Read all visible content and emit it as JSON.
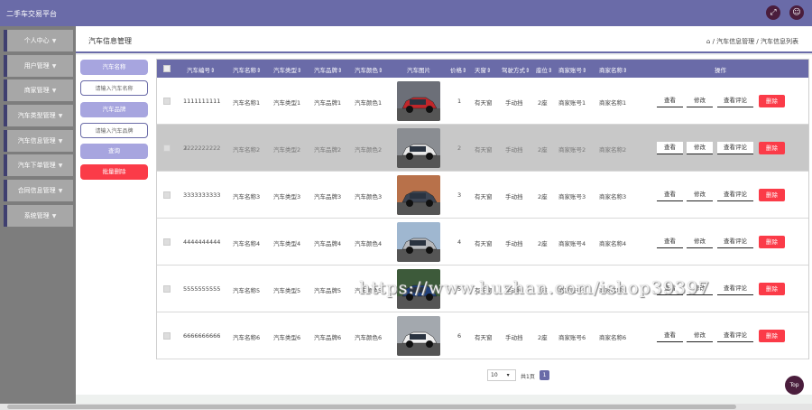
{
  "app": {
    "title": "二手车交易平台"
  },
  "icons": {
    "fullscreen": "fullscreen-icon",
    "user": "user-icon",
    "home": "home-icon"
  },
  "colors": {
    "accent": "#6a6ba8",
    "danger": "#fb3b48",
    "dark": "#4a1d3c"
  },
  "sidebar": {
    "items": [
      {
        "label": "个人中心"
      },
      {
        "label": "用户管理"
      },
      {
        "label": "商家管理"
      },
      {
        "label": "汽车类型管理"
      },
      {
        "label": "汽车信息管理"
      },
      {
        "label": "汽车下单管理"
      },
      {
        "label": "合同信息管理"
      },
      {
        "label": "系统管理"
      }
    ]
  },
  "header": {
    "title": "汽车信息管理",
    "breadcrumb": "/ 汽车信息管理 / 汽车信息列表"
  },
  "search": {
    "name_label": "汽车名称",
    "name_placeholder": "请输入汽车名称",
    "brand_label": "汽车品牌",
    "brand_placeholder": "请输入汽车品牌",
    "query": "查询",
    "batch_delete": "批量删除"
  },
  "table": {
    "headers": [
      "汽车编号",
      "汽车名称",
      "汽车类型",
      "汽车品牌",
      "汽车颜色",
      "汽车图片",
      "价格",
      "天窗",
      "驾驶方式",
      "座位",
      "商家账号",
      "商家名称",
      "操作"
    ],
    "actions": {
      "view": "查看",
      "edit": "修改",
      "review": "查看评论",
      "delete": "删除"
    },
    "rows": [
      {
        "id": "1111111111",
        "name": "汽车名称1",
        "type": "汽车类型1",
        "brand": "汽车品牌1",
        "color": "汽车颜色1",
        "price": "1",
        "sunroof": "有天窗",
        "drive": "手动挡",
        "seats": "2座",
        "acct": "商家账号1",
        "merchant": "商家名称1"
      },
      {
        "id": "2222222222",
        "name": "汽车名称2",
        "type": "汽车类型2",
        "brand": "汽车品牌2",
        "color": "汽车颜色2",
        "price": "2",
        "sunroof": "有天窗",
        "drive": "手动挡",
        "seats": "2座",
        "acct": "商家账号2",
        "merchant": "商家名称2"
      },
      {
        "id": "3333333333",
        "name": "汽车名称3",
        "type": "汽车类型3",
        "brand": "汽车品牌3",
        "color": "汽车颜色3",
        "price": "3",
        "sunroof": "有天窗",
        "drive": "手动挡",
        "seats": "2座",
        "acct": "商家账号3",
        "merchant": "商家名称3"
      },
      {
        "id": "4444444444",
        "name": "汽车名称4",
        "type": "汽车类型4",
        "brand": "汽车品牌4",
        "color": "汽车颜色4",
        "price": "4",
        "sunroof": "有天窗",
        "drive": "手动挡",
        "seats": "2座",
        "acct": "商家账号4",
        "merchant": "商家名称4"
      },
      {
        "id": "5555555555",
        "name": "汽车名称5",
        "type": "汽车类型5",
        "brand": "汽车品牌5",
        "color": "汽车颜色5",
        "price": "5",
        "sunroof": "有天窗",
        "drive": "手动挡",
        "seats": "2座",
        "acct": "商家账号5",
        "merchant": "商家名称5"
      },
      {
        "id": "6666666666",
        "name": "汽车名称6",
        "type": "汽车类型6",
        "brand": "汽车品牌6",
        "color": "汽车颜色6",
        "price": "6",
        "sunroof": "有天窗",
        "drive": "手动挡",
        "seats": "2座",
        "acct": "商家账号6",
        "merchant": "商家名称6"
      }
    ]
  },
  "pager": {
    "page_size": "10",
    "total": "共1页",
    "current": "1"
  },
  "back_to_top": "Top",
  "watermark": "https://www.huzhan.com/ishop39397"
}
